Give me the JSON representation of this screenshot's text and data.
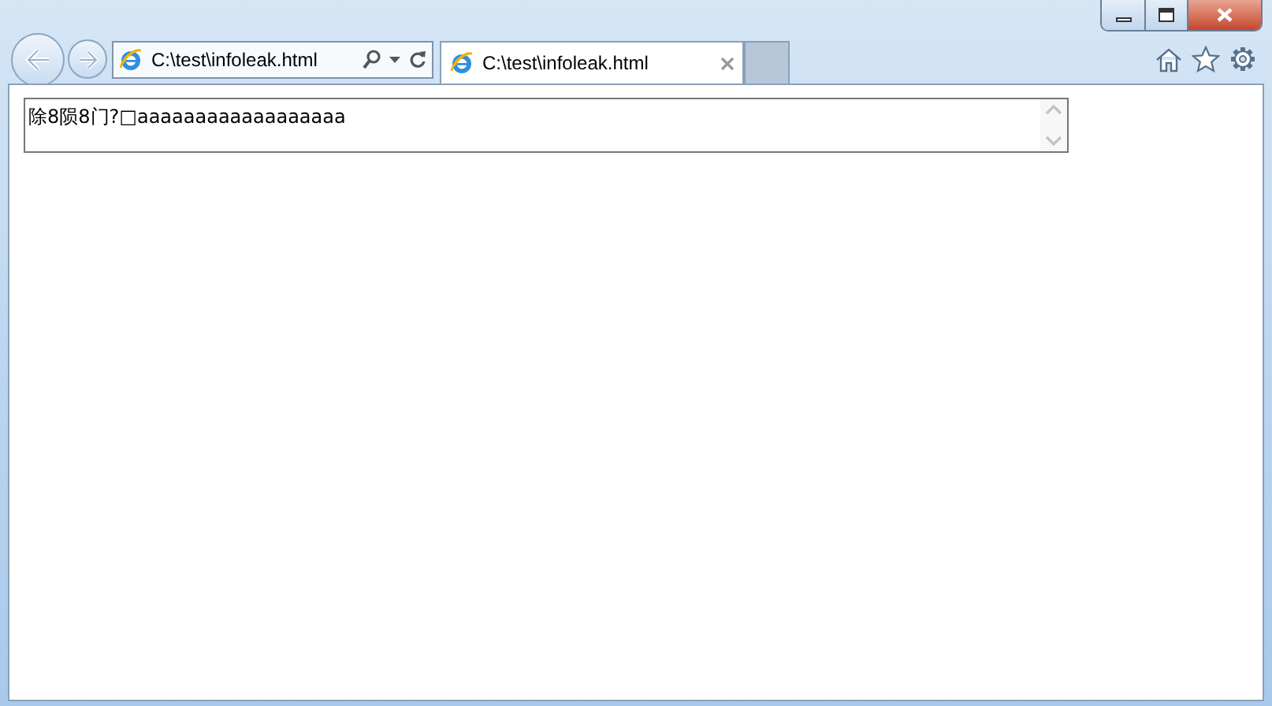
{
  "address_bar": {
    "value": "C:\\test\\infoleak.html"
  },
  "tabs": [
    {
      "title": "C:\\test\\infoleak.html",
      "selected": true
    }
  ],
  "page": {
    "text_area": {
      "value": "除8陨8门?□aaaaaaaaaaaaaaaaaa"
    }
  }
}
